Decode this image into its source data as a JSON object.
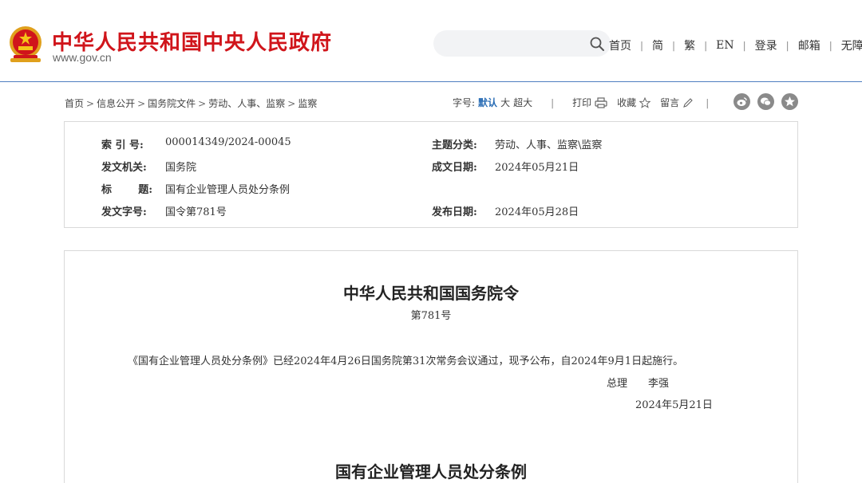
{
  "header": {
    "site_name": "中华人民共和国中央人民政府",
    "site_domain": "www.gov.cn",
    "search": {
      "value": "",
      "placeholder": ""
    },
    "nav": [
      {
        "label": "首页"
      },
      {
        "label": "简"
      },
      {
        "label": "繁"
      },
      {
        "label": "EN"
      },
      {
        "label": "登录"
      },
      {
        "label": "邮箱"
      },
      {
        "label": "无障碍"
      }
    ],
    "nav_separator": "|"
  },
  "breadcrumb": {
    "items": [
      "首页",
      "信息公开",
      "国务院文件",
      "劳动、人事、监察",
      "监察"
    ],
    "separator": ">"
  },
  "tools": {
    "font_size_label": "字号:",
    "font_default": "默认",
    "font_large": "大",
    "font_xlarge": "超大",
    "separator": "|",
    "print_label": "打印",
    "favorite_label": "收藏",
    "comment_label": "留言",
    "share": [
      "weibo-icon",
      "wechat-icon",
      "qzone-icon"
    ]
  },
  "info": {
    "index_label": "索 引 号:",
    "index_value": "000014349/2024-00045",
    "topic_label": "主题分类:",
    "topic_value": "劳动、人事、监察\\监察",
    "issuer_label": "发文机关:",
    "issuer_value": "国务院",
    "written_date_label": "成文日期:",
    "written_date_value": "2024年05月21日",
    "title_label_a": "标",
    "title_label_b": "题:",
    "title_value": "国有企业管理人员处分条例",
    "doc_no_label": "发文字号:",
    "doc_no_value": "国令第781号",
    "publish_date_label": "发布日期:",
    "publish_date_value": "2024年05月28日"
  },
  "article": {
    "title": "中华人民共和国国务院令",
    "number": "第781号",
    "body": "《国有企业管理人员处分条例》已经2024年4月26日国务院第31次常务会议通过，现予公布，自2024年9月1日起施行。",
    "signer_title": "总理",
    "signer_name": "李强",
    "sign_date": "2024年5月21日",
    "sub_title": "国有企业管理人员处分条例"
  },
  "colors": {
    "brand_red": "#d0151b",
    "link_blue": "#2a6db5",
    "header_border": "#4f7fc0"
  }
}
